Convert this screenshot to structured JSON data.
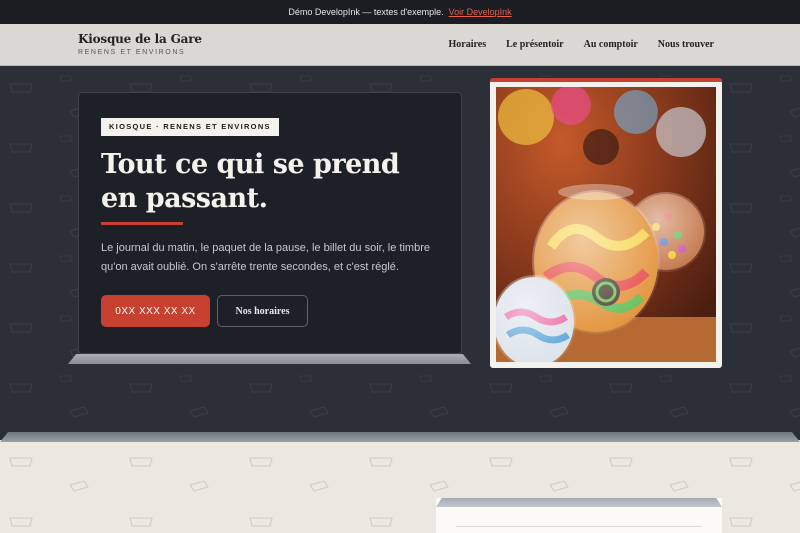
{
  "notice": {
    "text": "Démo DevelopInk — textes d'exemple.",
    "link": "Voir DevelopInk"
  },
  "header": {
    "brand_name": "Kiosque de la Gare",
    "brand_sub": "RENENS ET ENVIRONS",
    "nav": [
      "Horaires",
      "Le présentoir",
      "Au comptoir",
      "Nous trouver"
    ]
  },
  "hero": {
    "badge": "KIOSQUE · RENENS ET ENVIRONS",
    "headline_line1": "Tout ce qui se prend",
    "headline_line2": "en passant.",
    "lead": "Le journal du matin, le paquet de la pause, le billet du soir, le timbre qu'on avait oublié. On s'arrête trente secondes, et c'est réglé.",
    "phone_button": "0XX XXX XX XX",
    "hours_button": "Nos horaires"
  },
  "colors": {
    "accent": "#c8402f",
    "dark": "#1e2027",
    "header_bg": "#d9d8d3",
    "paper": "#f4f2ec"
  }
}
